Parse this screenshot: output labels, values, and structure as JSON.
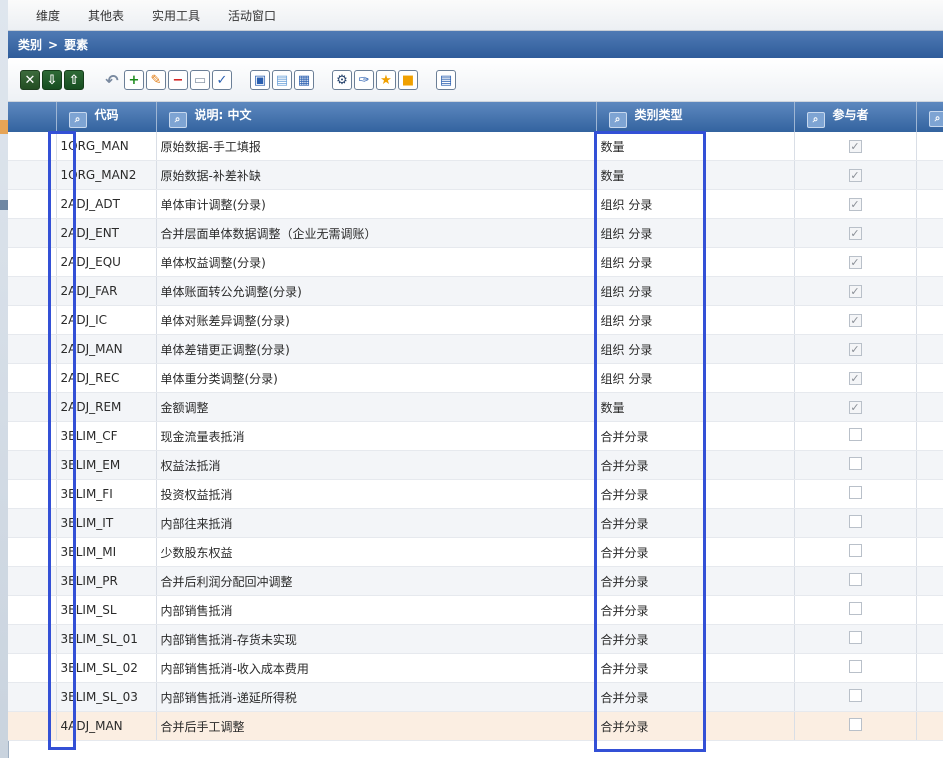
{
  "menu": [
    "维度",
    "其他表",
    "实用工具",
    "活动窗口"
  ],
  "breadcrumb": {
    "parent": "类别",
    "separator": ">",
    "current": "要素"
  },
  "toolbar": [
    {
      "icon": "excel-export-icon",
      "glyph": "✕",
      "style": "dark"
    },
    {
      "icon": "import-icon",
      "glyph": "⇩",
      "style": "dark2"
    },
    {
      "icon": "upload-icon",
      "glyph": "⇧",
      "style": "dark2"
    },
    {
      "icon": "undo-icon",
      "glyph": "↶",
      "style": "undo gap"
    },
    {
      "icon": "add-icon",
      "glyph": "+",
      "style": "plus"
    },
    {
      "icon": "edit-icon",
      "glyph": "✎",
      "style": "pen"
    },
    {
      "icon": "delete-icon",
      "glyph": "−",
      "style": "minus"
    },
    {
      "icon": "save-icon",
      "glyph": "▭",
      "style": "save"
    },
    {
      "icon": "check-icon",
      "glyph": "✓",
      "style": "check"
    },
    {
      "icon": "copy-icon",
      "glyph": "▣",
      "style": "copy gap"
    },
    {
      "icon": "copy-row-icon",
      "glyph": "▤",
      "style": "copy2"
    },
    {
      "icon": "paste-icon",
      "glyph": "▦",
      "style": "paste"
    },
    {
      "icon": "settings-icon",
      "glyph": "⚙",
      "style": "gear gap"
    },
    {
      "icon": "wrench-icon",
      "glyph": "✑",
      "style": "wrench"
    },
    {
      "icon": "star-icon",
      "glyph": "★",
      "style": "star"
    },
    {
      "icon": "orange-square-icon",
      "glyph": "■",
      "style": "sq"
    },
    {
      "icon": "document-icon",
      "glyph": "▤",
      "style": "doc gap"
    }
  ],
  "columns": {
    "code": "代码",
    "description": "说明: 中文",
    "category_type": "类别类型",
    "participant": "参与者"
  },
  "rows": [
    {
      "code": "1ORG_MAN",
      "desc": "原始数据-手工填报",
      "type": "数量",
      "participant": true
    },
    {
      "code": "1ORG_MAN2",
      "desc": "原始数据-补差补缺",
      "type": "数量",
      "participant": true
    },
    {
      "code": "2ADJ_ADT",
      "desc": "单体审计调整(分录)",
      "type": "组织 分录",
      "participant": true
    },
    {
      "code": "2ADJ_ENT",
      "desc": "合并层面单体数据调整（企业无需调账）",
      "type": "组织 分录",
      "participant": true
    },
    {
      "code": "2ADJ_EQU",
      "desc": "单体权益调整(分录)",
      "type": "组织 分录",
      "participant": true
    },
    {
      "code": "2ADJ_FAR",
      "desc": "单体账面转公允调整(分录)",
      "type": "组织 分录",
      "participant": true
    },
    {
      "code": "2ADJ_IC",
      "desc": "单体对账差异调整(分录)",
      "type": "组织 分录",
      "participant": true
    },
    {
      "code": "2ADJ_MAN",
      "desc": "单体差错更正调整(分录)",
      "type": "组织 分录",
      "participant": true
    },
    {
      "code": "2ADJ_REC",
      "desc": "单体重分类调整(分录)",
      "type": "组织 分录",
      "participant": true
    },
    {
      "code": "2ADJ_REM",
      "desc": "金额调整",
      "type": "数量",
      "participant": true
    },
    {
      "code": "3ELIM_CF",
      "desc": "现金流量表抵消",
      "type": "合并分录",
      "participant": false
    },
    {
      "code": "3ELIM_EM",
      "desc": "权益法抵消",
      "type": "合并分录",
      "participant": false
    },
    {
      "code": "3ELIM_FI",
      "desc": "投资权益抵消",
      "type": "合并分录",
      "participant": false
    },
    {
      "code": "3ELIM_IT",
      "desc": "内部往来抵消",
      "type": "合并分录",
      "participant": false
    },
    {
      "code": "3ELIM_MI",
      "desc": "少数股东权益",
      "type": "合并分录",
      "participant": false
    },
    {
      "code": "3ELIM_PR",
      "desc": "合并后利润分配回冲调整",
      "type": "合并分录",
      "participant": false
    },
    {
      "code": "3ELIM_SL",
      "desc": "内部销售抵消",
      "type": "合并分录",
      "participant": false
    },
    {
      "code": "3ELIM_SL_01",
      "desc": "内部销售抵消-存货未实现",
      "type": "合并分录",
      "participant": false
    },
    {
      "code": "3ELIM_SL_02",
      "desc": "内部销售抵消-收入成本费用",
      "type": "合并分录",
      "participant": false
    },
    {
      "code": "3ELIM_SL_03",
      "desc": "内部销售抵消-递延所得税",
      "type": "合并分录",
      "participant": false
    },
    {
      "code": "4ADJ_MAN",
      "desc": "合并后手工调整",
      "type": "合并分录",
      "participant": false,
      "selected": true
    }
  ]
}
